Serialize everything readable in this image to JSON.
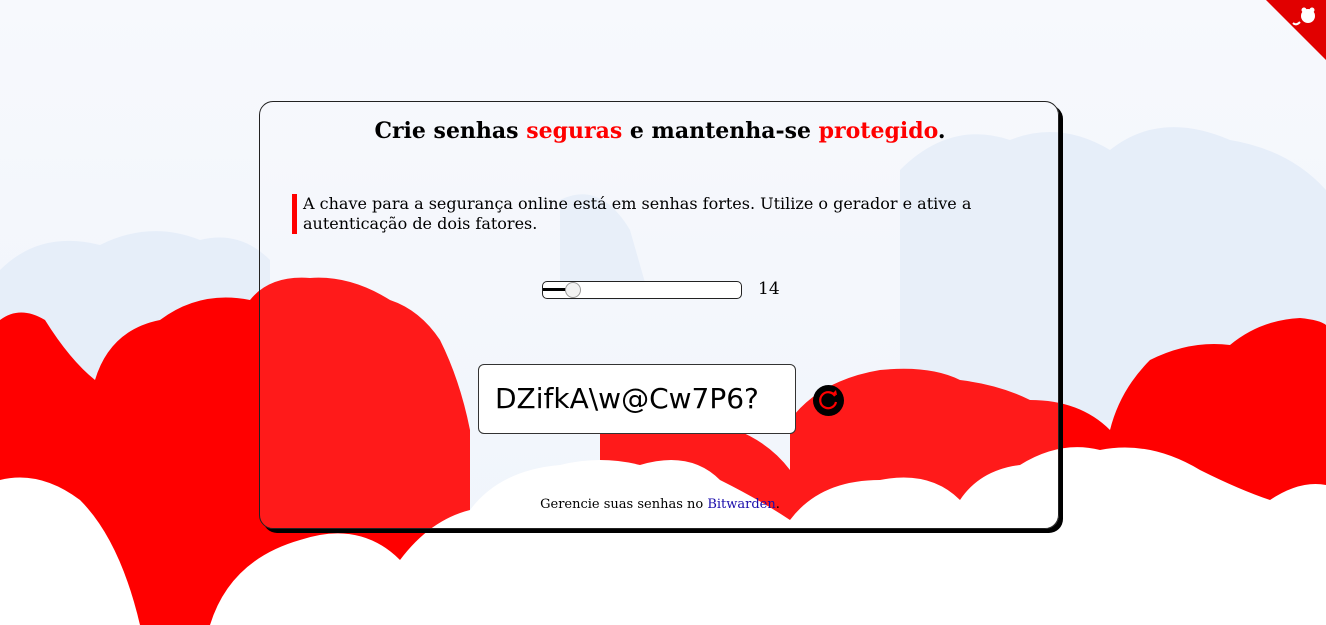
{
  "headline": {
    "part1": "Crie senhas ",
    "accent1": "seguras",
    "part2": " e mantenha-se ",
    "accent2": "protegido",
    "part3": "."
  },
  "intro_text": "A chave para a segurança online está em senhas fortes. Utilize o gerador e ative a autenticação de dois fatores.",
  "length_slider": {
    "value": "14",
    "fill_fraction": 0.12
  },
  "password": {
    "value": "DZifkA\\w@Cw7P6?"
  },
  "refresh_button": {
    "icon": "refresh-icon"
  },
  "footer": {
    "text_before": "Gerencie suas senhas no ",
    "link_label": "Bitwarden",
    "text_after": "."
  },
  "corner_icon": "github-icon",
  "colors": {
    "accent": "#ff0000",
    "link": "#1a0dab",
    "cloud": "#ffffff",
    "background": "#f4f7fc"
  }
}
